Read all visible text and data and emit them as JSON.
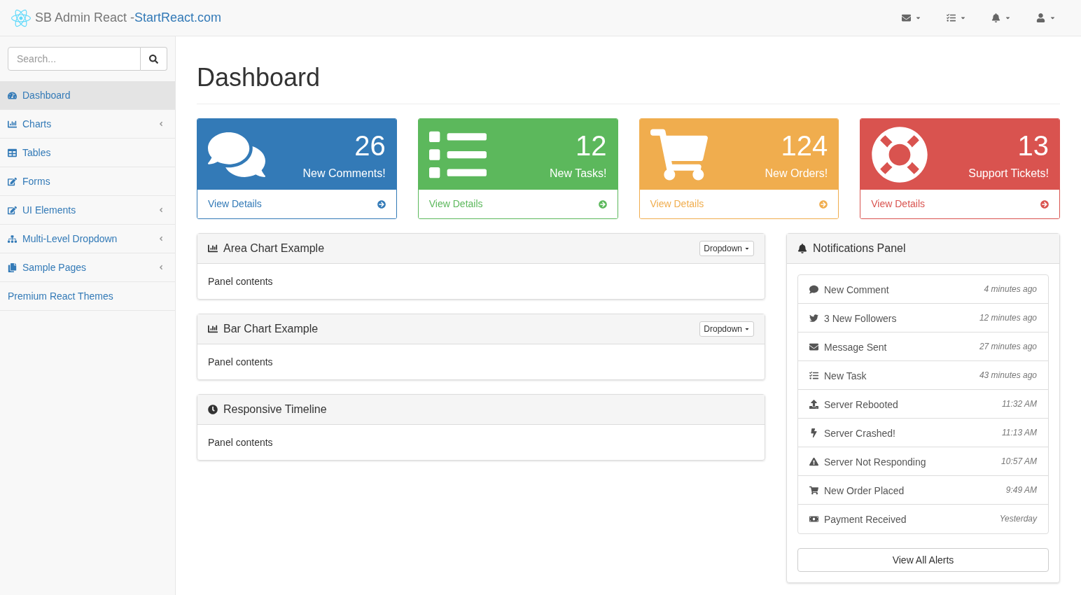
{
  "navbar": {
    "brand": "SB Admin React - ",
    "brand_link": "StartReact.com"
  },
  "search": {
    "placeholder": "Search..."
  },
  "sidebar": {
    "items": [
      {
        "label": "Dashboard",
        "selected": true,
        "expandable": false
      },
      {
        "label": "Charts",
        "selected": false,
        "expandable": true
      },
      {
        "label": "Tables",
        "selected": false,
        "expandable": false
      },
      {
        "label": "Forms",
        "selected": false,
        "expandable": false
      },
      {
        "label": "UI Elements",
        "selected": false,
        "expandable": true
      },
      {
        "label": "Multi-Level Dropdown",
        "selected": false,
        "expandable": true
      },
      {
        "label": "Sample Pages",
        "selected": false,
        "expandable": true
      },
      {
        "label": "Premium React Themes",
        "selected": false,
        "expandable": false
      }
    ]
  },
  "page_title": "Dashboard",
  "stat_cards": [
    {
      "count": "26",
      "label": "New Comments!",
      "link": "View Details",
      "color": "#337ab7"
    },
    {
      "count": "12",
      "label": "New Tasks!",
      "link": "View Details",
      "color": "#5cb85c"
    },
    {
      "count": "124",
      "label": "New Orders!",
      "link": "View Details",
      "color": "#f0ad4e"
    },
    {
      "count": "13",
      "label": "Support Tickets!",
      "link": "View Details",
      "color": "#d9534f"
    }
  ],
  "panels": [
    {
      "title": "Area Chart Example",
      "dropdown": "Dropdown",
      "body": "Panel contents"
    },
    {
      "title": "Bar Chart Example",
      "dropdown": "Dropdown",
      "body": "Panel contents"
    },
    {
      "title": "Responsive Timeline",
      "body": "Panel contents"
    }
  ],
  "notifications": {
    "title": "Notifications Panel",
    "items": [
      {
        "label": "New Comment",
        "time": "4 minutes ago"
      },
      {
        "label": "3 New Followers",
        "time": "12 minutes ago"
      },
      {
        "label": "Message Sent",
        "time": "27 minutes ago"
      },
      {
        "label": "New Task",
        "time": "43 minutes ago"
      },
      {
        "label": "Server Rebooted",
        "time": "11:32 AM"
      },
      {
        "label": "Server Crashed!",
        "time": "11:13 AM"
      },
      {
        "label": "Server Not Responding",
        "time": "10:57 AM"
      },
      {
        "label": "New Order Placed",
        "time": "9:49 AM"
      },
      {
        "label": "Payment Received",
        "time": "Yesterday"
      }
    ],
    "button": "View All Alerts"
  }
}
